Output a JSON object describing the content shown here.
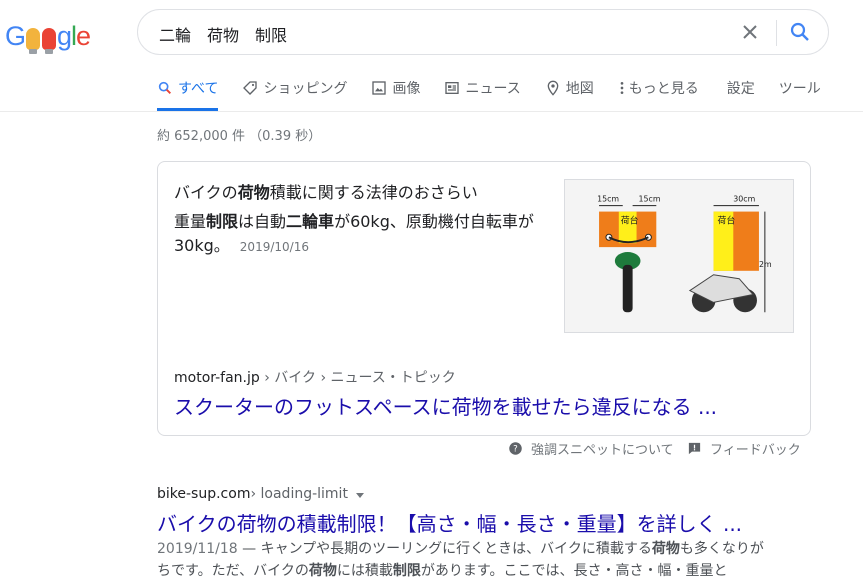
{
  "logo": {
    "letters": [
      "G",
      "",
      "",
      "g",
      "l",
      "e"
    ],
    "alt": "Google"
  },
  "search": {
    "query": "二輪　荷物　制限"
  },
  "tabs": [
    {
      "label": "すべて",
      "icon": "search-icon",
      "active": true
    },
    {
      "label": "ショッピング",
      "icon": "tag-icon"
    },
    {
      "label": "画像",
      "icon": "image-icon"
    },
    {
      "label": "ニュース",
      "icon": "news-icon"
    },
    {
      "label": "地図",
      "icon": "map-pin-icon"
    },
    {
      "label": "もっと見る",
      "icon": "more-vert-icon"
    }
  ],
  "tools": {
    "settings": "設定",
    "tools": "ツール"
  },
  "result_stats": "約 652,000 件 （0.39 秒）",
  "snippet": {
    "title_pre": "バイクの",
    "title_bold": "荷物",
    "title_post": "積載に関する法律のおさらい",
    "body": [
      {
        "text": "重量",
        "bold": false
      },
      {
        "text": "制限",
        "bold": true
      },
      {
        "text": "は自動",
        "bold": false
      },
      {
        "text": "二輪車",
        "bold": true
      },
      {
        "text": "が60kg、原動機付自転車が30kg。",
        "bold": false
      }
    ],
    "date": "2019/10/16",
    "image_labels": {
      "w1": "15cm",
      "w2": "15cm",
      "w3": "30cm",
      "h": "2m",
      "cargo": "荷台"
    },
    "site": "motor-fan.jp",
    "breadcrumb": " › バイク › ニュース・トピック",
    "link": "スクーターのフットスペースに荷物を載せたら違反になる ..."
  },
  "feedback": {
    "about": "強調スニペットについて",
    "feedback": "フィードバック"
  },
  "result2": {
    "site": "bike-sup.com",
    "breadcrumb": " › loading-limit",
    "title": "バイクの荷物の積載制限！【高さ・幅・長さ・重量】を詳しく ...",
    "date": "2019/11/18",
    "snippet": [
      {
        "text": " — キャンプや長期のツーリングに行くときは、バイクに積載する",
        "bold": false
      },
      {
        "text": "荷物",
        "bold": true
      },
      {
        "text": "も多くなりがちです。ただ、バイクの",
        "bold": false
      },
      {
        "text": "荷物",
        "bold": true
      },
      {
        "text": "には積載",
        "bold": false
      },
      {
        "text": "制限",
        "bold": true
      },
      {
        "text": "があります。ここでは、長さ・高さ・幅・重量と",
        "bold": false
      }
    ]
  },
  "colors": {
    "link": "#1a0dab",
    "accent": "#1a73e8",
    "muted": "#70757a"
  }
}
